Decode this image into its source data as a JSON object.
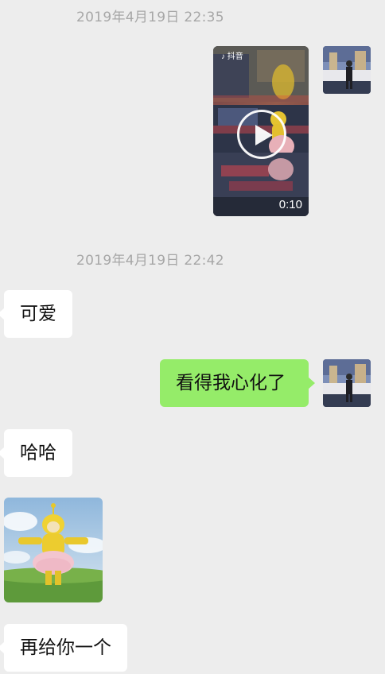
{
  "chat": {
    "messages": [
      {
        "type": "timestamp",
        "text": "2019年4月19日 22:35"
      },
      {
        "type": "video",
        "side": "right",
        "duration": "0:10",
        "source_logo": "抖音"
      },
      {
        "type": "timestamp",
        "text": "2019年4月19日 22:42"
      },
      {
        "type": "text",
        "side": "left",
        "text": "可爱"
      },
      {
        "type": "text",
        "side": "right",
        "text": "看得我心化了"
      },
      {
        "type": "text",
        "side": "left",
        "text": "哈哈"
      },
      {
        "type": "image",
        "side": "left",
        "icon": "teletubby-sticker"
      },
      {
        "type": "text",
        "side": "left",
        "text": "再给你一个"
      }
    ]
  },
  "colors": {
    "background": "#ededed",
    "sent_bubble": "#95ec69",
    "received_bubble": "#ffffff",
    "timestamp": "#a7a7a7"
  }
}
